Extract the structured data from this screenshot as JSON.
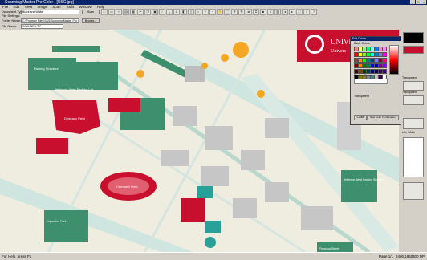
{
  "window": {
    "title": "Scanning Master Pro Color - [USC.jpg]"
  },
  "menu": [
    "File",
    "Edit",
    "View",
    "Image",
    "Scan",
    "Tools",
    "Window",
    "Help"
  ],
  "form": {
    "doc_type_label": "Document Type:",
    "doc_type_value": "Black and White",
    "file_settings_label": "File Settings:",
    "folder_label": "Folder Name:",
    "folder_value": "C:\\Program Files\\SSS\\Scanning Master Pro Color\\",
    "browse_label": "Browse...",
    "filename_label": "File Name:",
    "filename_value": "SCANNED.TIF",
    "scan_label": "Scan"
  },
  "map": {
    "logo_text": "UNIVERSITY",
    "logo_subtext": "Univers",
    "field_labels": [
      "Jefferson West Parking Lot",
      "Parking Structure",
      "Dedeaux Field",
      "Cromwell Field",
      "Jefferson West Parking Structure",
      "Exposition Park",
      "Figueroa Street"
    ]
  },
  "color_dialog": {
    "title": "Edit Colors",
    "basic_label": "Basic Colors",
    "custom_label": "Custom Colors",
    "close_label": "Close",
    "new_color_label": "New Color Combination",
    "transparent_label": "Transparent",
    "colors": [
      "#ff8080",
      "#ffff80",
      "#80ff80",
      "#00ff80",
      "#80ffff",
      "#0080ff",
      "#ff80c0",
      "#ff80ff",
      "#ff0000",
      "#ffff00",
      "#80ff00",
      "#00ff40",
      "#00ffff",
      "#0080c0",
      "#8080c0",
      "#ff00ff",
      "#804040",
      "#ff8040",
      "#00ff00",
      "#008080",
      "#004080",
      "#8080ff",
      "#800040",
      "#ff0080",
      "#800000",
      "#ff8000",
      "#008000",
      "#008040",
      "#0000ff",
      "#0000a0",
      "#800080",
      "#8000ff",
      "#400000",
      "#804000",
      "#004000",
      "#004040",
      "#000080",
      "#000040",
      "#400040",
      "#400080",
      "#000000",
      "#808000",
      "#808040",
      "#808080",
      "#408080",
      "#c0c0c0",
      "#400040",
      "#ffffff"
    ]
  },
  "right_panel": {
    "transparent_1": "Transparent",
    "transparent_2": "Transparent",
    "use_width": "Use Width"
  },
  "status": {
    "left": "For Help, press F1",
    "page": "Page 1/1",
    "size": "2400,1960",
    "dpi": "300 DPI"
  }
}
